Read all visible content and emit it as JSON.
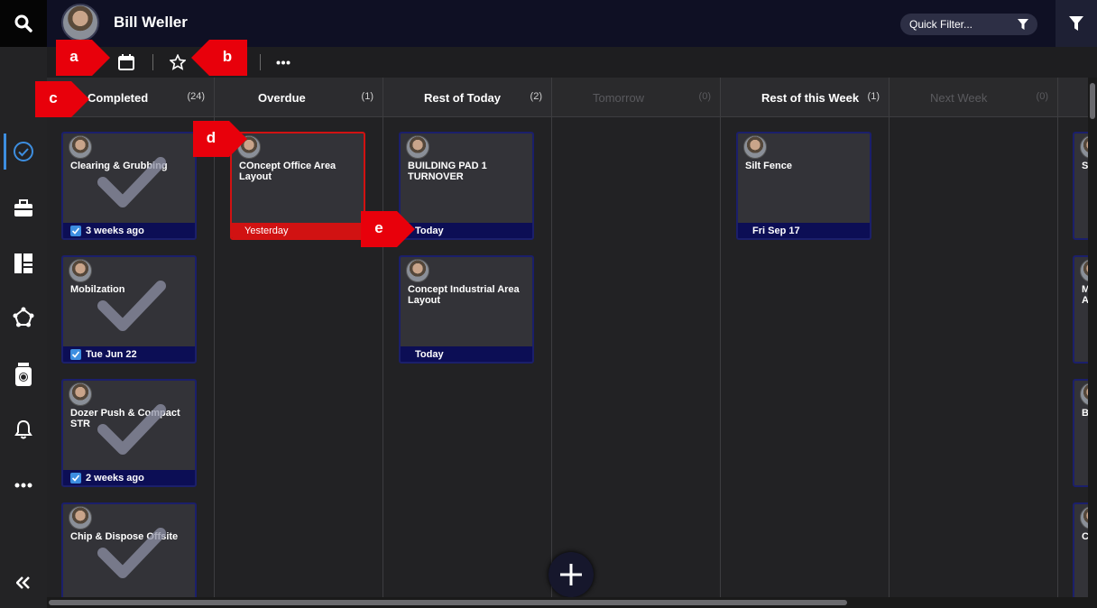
{
  "header": {
    "user_name": "Bill Weller",
    "quick_filter_placeholder": "Quick Filter..."
  },
  "sidebar": {
    "items": [
      {
        "icon": "check-circle-icon",
        "active": true
      },
      {
        "icon": "briefcase-icon"
      },
      {
        "icon": "layout-panels-icon"
      },
      {
        "icon": "network-icon"
      },
      {
        "icon": "timer-jar-icon"
      },
      {
        "icon": "bell-icon"
      },
      {
        "icon": "more-icon"
      }
    ],
    "collapse_icon": "collapse-icon"
  },
  "toolbar": {
    "items": [
      "calendar-icon",
      "star-icon",
      "more-icon"
    ]
  },
  "callouts": [
    "a",
    "b",
    "c",
    "d",
    "e"
  ],
  "columns": [
    {
      "title": "Completed",
      "count": "(24)",
      "dim": false
    },
    {
      "title": "Overdue",
      "count": "(1)",
      "dim": false
    },
    {
      "title": "Rest of Today",
      "count": "(2)",
      "dim": false
    },
    {
      "title": "Tomorrow",
      "count": "(0)",
      "dim": true
    },
    {
      "title": "Rest of this Week",
      "count": "(1)",
      "dim": false
    },
    {
      "title": "Next Week",
      "count": "(0)",
      "dim": true
    }
  ],
  "cards": {
    "completed": [
      {
        "title": "Clearing & Grubbing",
        "footer": "3 weeks ago"
      },
      {
        "title": "Mobilzation",
        "footer": "Tue Jun 22"
      },
      {
        "title": "Dozer Push & Compact STR",
        "footer": "2 weeks ago"
      },
      {
        "title": "Chip & Dispose Offsite",
        "footer": ""
      }
    ],
    "overdue": [
      {
        "title": "COncept Office Area Layout",
        "footer": "Yesterday"
      }
    ],
    "rest_of_today": [
      {
        "title": "BUILDING PAD 1 TURNOVER",
        "footer": "Today"
      },
      {
        "title": "Concept Industrial Area Layout",
        "footer": "Today"
      }
    ],
    "rest_of_week": [
      {
        "title": "Silt Fence",
        "footer": "Fri Sep 17"
      }
    ],
    "partial_right": [
      "S",
      "M",
      "A",
      "B",
      "C"
    ]
  },
  "colors": {
    "accent": "#3d8ee0",
    "card_border": "#1b1f6b",
    "overdue": "#d11212",
    "callout": "#e8000b"
  }
}
